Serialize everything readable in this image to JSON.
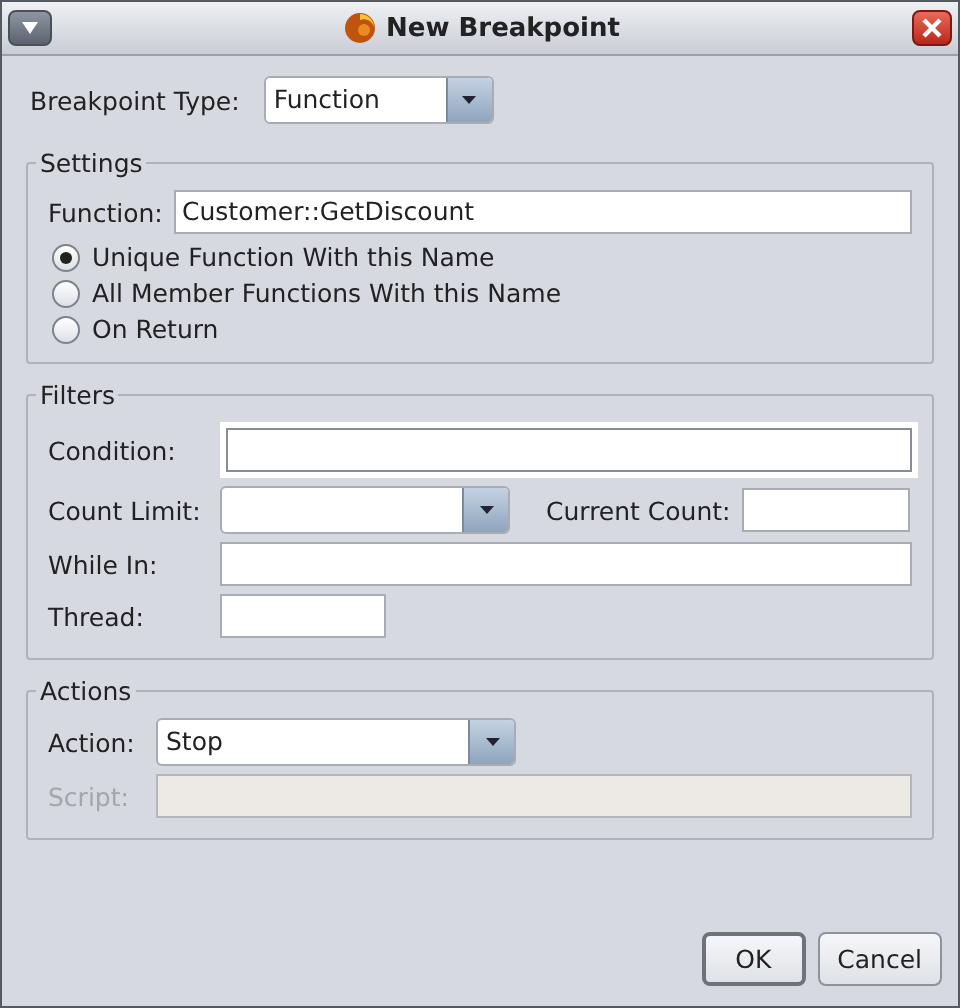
{
  "window": {
    "title": "New Breakpoint"
  },
  "breakpoint_type": {
    "label": "Breakpoint Type:",
    "value": "Function"
  },
  "settings": {
    "title": "Settings",
    "function": {
      "label": "Function:",
      "value": "Customer::GetDiscount"
    },
    "options": [
      {
        "label": "Unique Function With this Name",
        "selected": true
      },
      {
        "label": "All Member Functions With this Name",
        "selected": false
      },
      {
        "label": "On Return",
        "selected": false
      }
    ]
  },
  "filters": {
    "title": "Filters",
    "condition": {
      "label": "Condition:",
      "focused": true
    },
    "count_limit": {
      "label": "Count Limit:"
    },
    "current_count": {
      "label": "Current Count:"
    },
    "while_in": {
      "label": "While In:"
    },
    "thread": {
      "label": "Thread:"
    }
  },
  "actions": {
    "title": "Actions",
    "action": {
      "label": "Action:",
      "value": "Stop"
    },
    "script": {
      "label": "Script:",
      "disabled": true
    }
  },
  "buttons": [
    {
      "label": "OK",
      "default": true
    },
    {
      "label": "Cancel",
      "default": false
    }
  ]
}
